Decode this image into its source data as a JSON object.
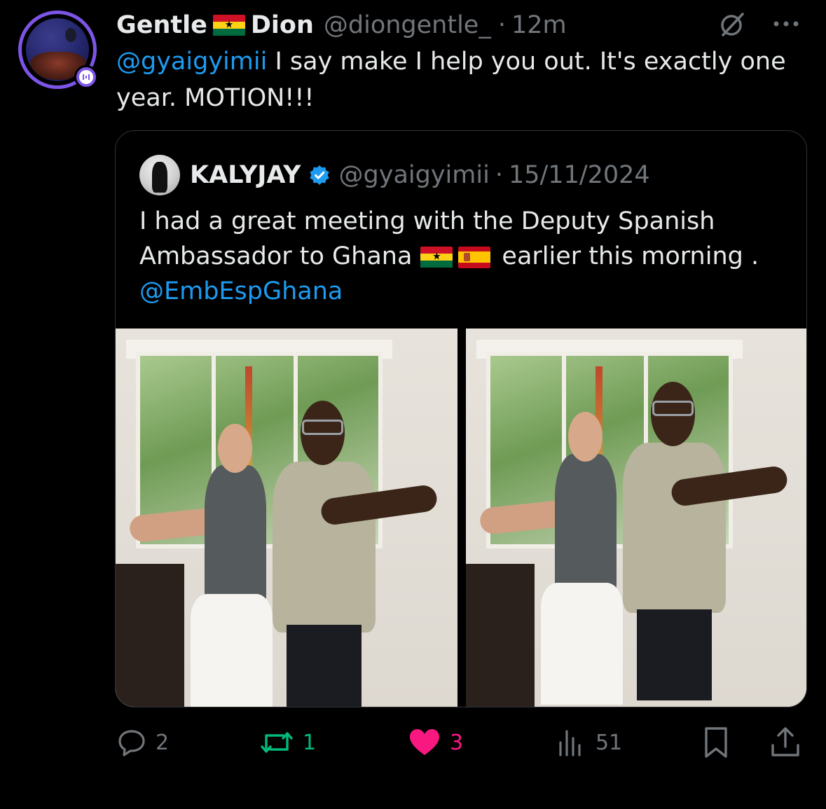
{
  "tweet": {
    "author_name_part1": "Gentle",
    "author_name_part2": "Dion",
    "author_handle": "@diongentle_",
    "separator": "·",
    "time": "12m",
    "mention": "@gyaigyimii",
    "text": " I say make I help you out. It's exactly one year. MOTION!!!",
    "icons": [
      "grok-icon",
      "more-icon",
      "ghana-flag",
      "avatar-badge-icon"
    ]
  },
  "quote": {
    "author_name": "KALYJAY",
    "author_handle": "@gyaigyimii",
    "separator": "·",
    "date": "15/11/2024",
    "text_part1": "I had a great meeting with the Deputy Spanish Ambassador to Ghana",
    "text_part2": "earlier this morning .",
    "mention": "@EmbEspGhana",
    "flags": [
      "ghana-flag",
      "spain-flag"
    ],
    "verified_color": "#1d9bf0",
    "photos": [
      "photo-1",
      "photo-2"
    ]
  },
  "actions": {
    "reply_count": "2",
    "retweet_count": "1",
    "like_count": "3",
    "views_count": "51",
    "colors": {
      "retweet": "#00ba7c",
      "like": "#f91880",
      "muted": "#71767b"
    }
  },
  "colors": {
    "accent": "#1d9bf0",
    "badge": "#7c55e6",
    "background": "#000000"
  }
}
